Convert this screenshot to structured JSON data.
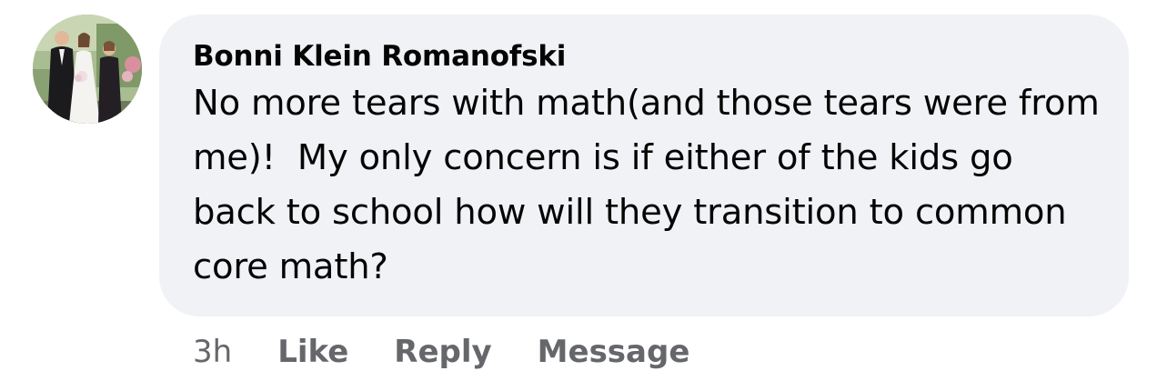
{
  "comment": {
    "author": "Bonni Klein Romanofski",
    "text": "No more tears with math(and those tears were from me)!  My only concern is if either of the kids go back to school how will they transition to common core math?",
    "timestamp": "3h",
    "actions": {
      "like": "Like",
      "reply": "Reply",
      "message": "Message"
    }
  },
  "colors": {
    "bubble_bg": "#f0f2f5",
    "text": "#050505",
    "secondary_text": "#65676b"
  }
}
